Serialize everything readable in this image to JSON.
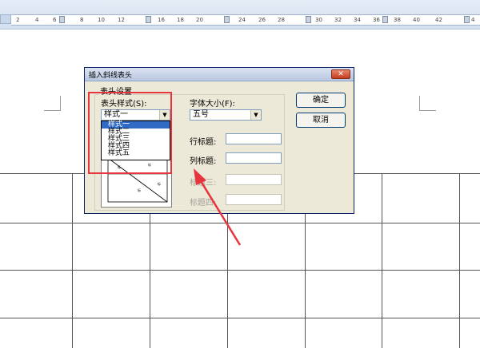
{
  "ruler": {
    "numbers": [
      "2",
      "4",
      "6",
      "8",
      "10",
      "12",
      "16",
      "18",
      "20",
      "24",
      "26",
      "28",
      "30",
      "32",
      "34",
      "36",
      "38",
      "40",
      "42",
      "4"
    ]
  },
  "dialog": {
    "title": "插入斜线表头",
    "close_label": "✕",
    "group_label": "表头设置",
    "style_label": "表头样式(S):",
    "style_value": "样式一",
    "style_options": [
      "样式一",
      "样式二",
      "样式三",
      "样式四",
      "样式五"
    ],
    "font_size_label": "字体大小(F):",
    "font_size_value": "五号",
    "row_title_label": "行标题:",
    "col_title_label": "列标题:",
    "title3_label": "标题三:",
    "title4_label": "标题四:",
    "ok_label": "确定",
    "cancel_label": "取消",
    "preview": {
      "labels": [
        "标",
        "标",
        "标",
        "标"
      ]
    }
  },
  "colors": {
    "annotation": "#e8343c",
    "selection": "#316ac5"
  }
}
